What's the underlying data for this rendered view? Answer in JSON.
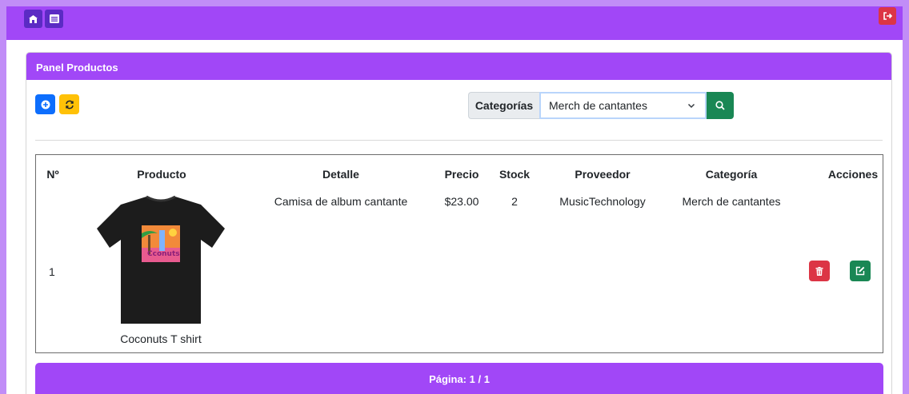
{
  "navbar": {
    "buttons": [
      {
        "icon": "store-icon"
      },
      {
        "icon": "list-icon"
      }
    ],
    "logout_icon": "logout-icon"
  },
  "panel": {
    "title": "Panel Productos",
    "toolbar": {
      "add_icon": "plus-circle-icon",
      "refresh_icon": "refresh-icon"
    },
    "filter": {
      "label": "Categorías",
      "selected": "Merch de cantantes",
      "search_icon": "search-icon"
    },
    "table": {
      "columns": [
        "Nº",
        "Producto",
        "Detalle",
        "Precio",
        "Stock",
        "Proveedor",
        "Categoría",
        "Acciones"
      ],
      "rows": [
        {
          "num": "1",
          "product": "Coconuts T shirt",
          "detail": "Camisa de album cantante",
          "price": "$23.00",
          "stock": "2",
          "provider": "MusicTechnology",
          "category": "Merch de cantantes"
        }
      ]
    },
    "pagination": "Página: 1 / 1"
  },
  "colors": {
    "primary": "#a147f7",
    "nav_button": "#5b2bc4",
    "danger": "#dc3545",
    "success": "#198754",
    "info": "#0d6efd",
    "warning": "#ffc107"
  }
}
